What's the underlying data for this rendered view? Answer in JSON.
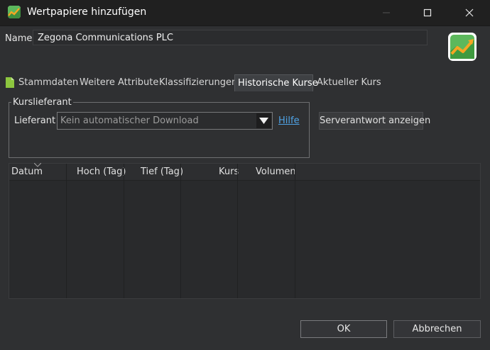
{
  "window": {
    "title": "Wertpapiere hinzufügen",
    "app_icon": "portfolio-chart-icon",
    "controls": [
      "minimize-icon",
      "maximize-icon",
      "close-icon"
    ]
  },
  "name_field": {
    "label": "Name",
    "value": "Zegona Communications PLC"
  },
  "tabs": [
    {
      "label": "Stammdaten",
      "icon": "document-icon"
    },
    {
      "label": "Weitere Attribute"
    },
    {
      "label": "Klassifizierungen"
    },
    {
      "label": "Historische Kurse",
      "active": true
    },
    {
      "label": "Aktueller Kurs"
    }
  ],
  "quote_provider": {
    "group_label": "Kurslieferant",
    "provider_label": "Lieferant",
    "provider_value": "Kein automatischer Download",
    "help_link": "Hilfe",
    "server_response_button": "Serverantwort anzeigen"
  },
  "table": {
    "columns": [
      "Datum",
      "Hoch (Tag)",
      "Tief (Tag)",
      "Kurs",
      "Volumen"
    ],
    "sorted_column": "Datum",
    "rows": []
  },
  "footer": {
    "ok": "OK",
    "cancel": "Abbrechen"
  },
  "colors": {
    "background": "#2f3032",
    "titlebar": "#202020",
    "link": "#4fa3e6",
    "logo_green": "#5cb85c",
    "logo_orange": "#f5a623"
  }
}
